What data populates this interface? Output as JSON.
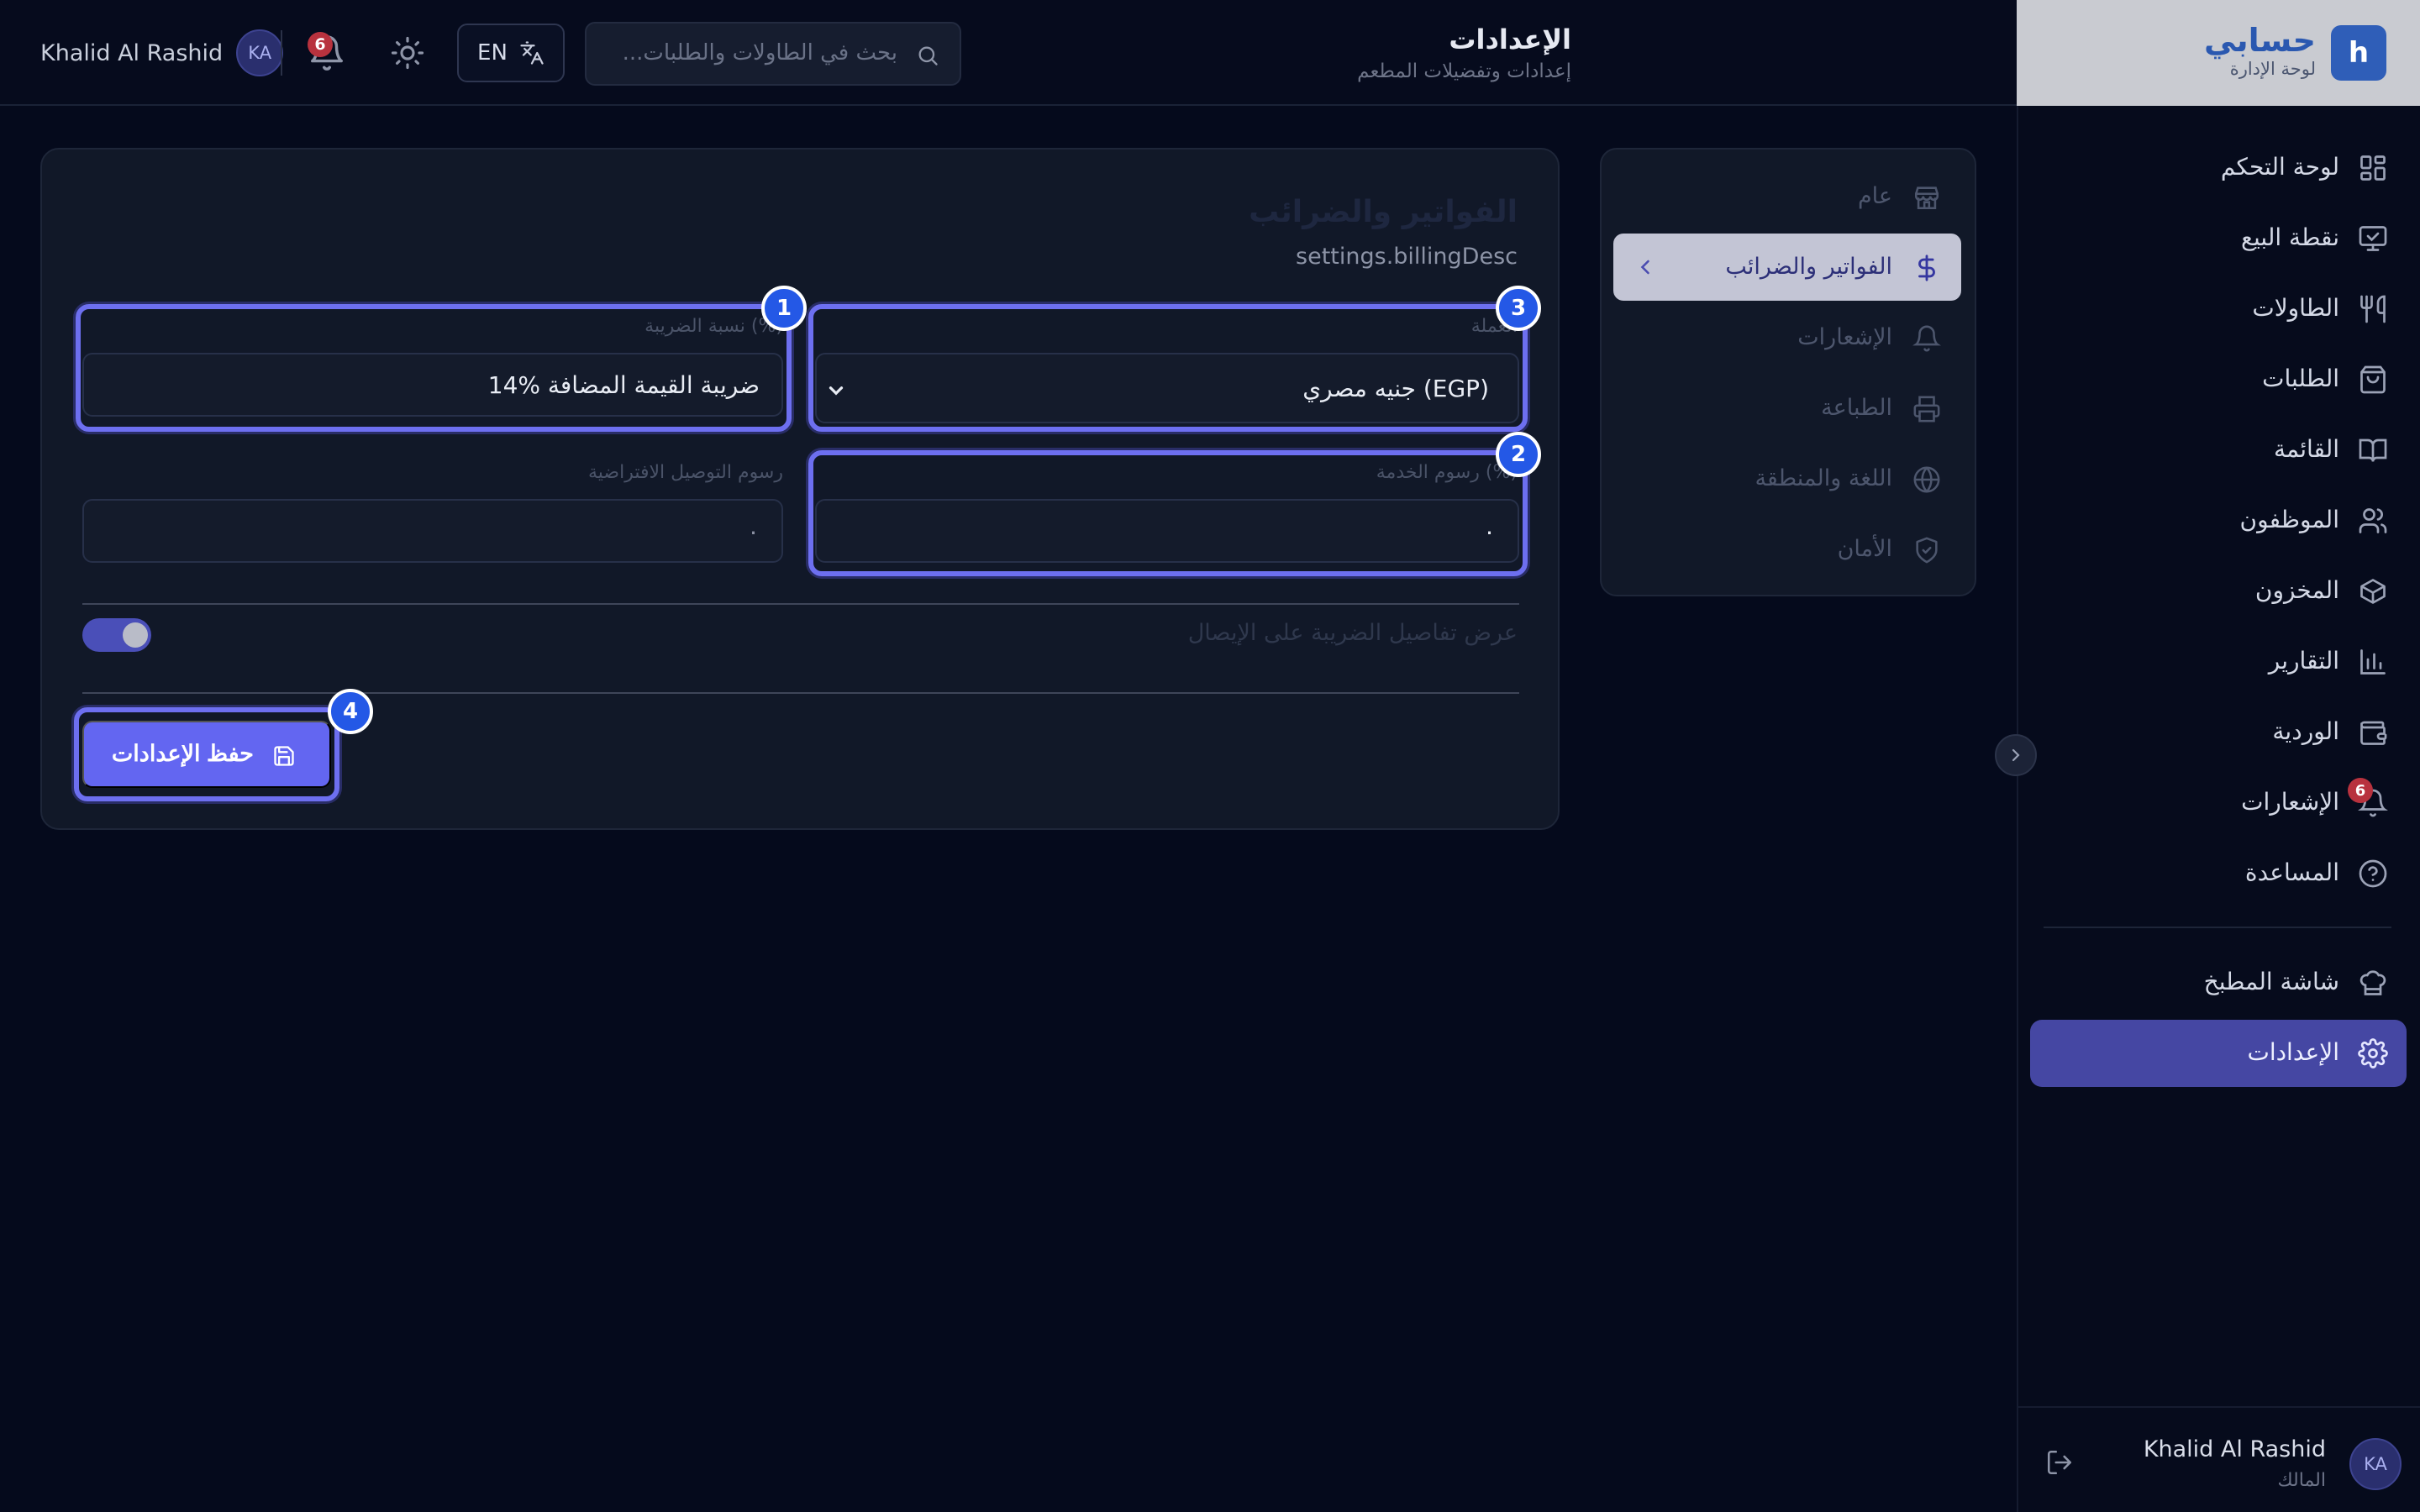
{
  "brand": {
    "name": "حسابي",
    "subtitle": "لوحة الإدارة",
    "logo_letter": "h",
    "logo_color": "#2f5eb8"
  },
  "header": {
    "title": "الإعدادات",
    "subtitle": "إعدادات وتفضيلات المطعم",
    "search_placeholder": "بحث في الطاولات والطلبات...",
    "language": "EN",
    "notifications_count": "6",
    "user": {
      "name": "Khalid Al Rashid",
      "initials": "KA"
    }
  },
  "sidebar": {
    "items": [
      {
        "label": "لوحة التحكم",
        "icon": "dashboard-grid-icon"
      },
      {
        "label": "نقطة البيع",
        "icon": "monitor-icon"
      },
      {
        "label": "الطاولات",
        "icon": "utensils-icon"
      },
      {
        "label": "الطلبات",
        "icon": "shopping-bag-icon"
      },
      {
        "label": "القائمة",
        "icon": "book-open-icon"
      },
      {
        "label": "الموظفون",
        "icon": "users-icon"
      },
      {
        "label": "المخزون",
        "icon": "package-icon"
      },
      {
        "label": "التقارير",
        "icon": "bar-chart-icon"
      },
      {
        "label": "الوردية",
        "icon": "wallet-icon"
      },
      {
        "label": "الإشعارات",
        "icon": "bell-icon",
        "badge": "6"
      },
      {
        "label": "المساعدة",
        "icon": "help-circle-icon"
      }
    ],
    "secondary_items": [
      {
        "label": "شاشة المطبخ",
        "icon": "chef-hat-icon"
      },
      {
        "label": "الإعدادات",
        "icon": "gear-icon",
        "active": true
      }
    ],
    "user": {
      "name": "Khalid Al Rashid",
      "role": "المالك",
      "initials": "KA"
    }
  },
  "settings_nav": {
    "items": [
      {
        "label": "عام",
        "icon": "store-icon"
      },
      {
        "label": "الفواتير والضرائب",
        "icon": "dollar-icon",
        "active": true
      },
      {
        "label": "الإشعارات",
        "icon": "bell-icon"
      },
      {
        "label": "الطباعة",
        "icon": "printer-icon"
      },
      {
        "label": "اللغة والمنطقة",
        "icon": "globe-icon"
      },
      {
        "label": "الأمان",
        "icon": "shield-check-icon"
      }
    ]
  },
  "billing": {
    "title": "الفواتير والضرائب",
    "description": "settings.billingDesc",
    "currency_label": "العملة",
    "currency_value": "جنيه مصري (EGP)",
    "tax_label": "نسبة الضريبة (%)",
    "tax_value": "14% ضريبة القيمة المضافة",
    "service_label": "رسوم الخدمة (%)",
    "service_value": "٠",
    "delivery_label": "رسوم التوصيل الافتراضية",
    "delivery_value": "٠",
    "toggle_label": "عرض تفاصيل الضريبة على الإيصال",
    "toggle_on": true,
    "save_label": "حفظ الإعدادات"
  },
  "markers": [
    "1",
    "2",
    "3",
    "4"
  ],
  "colors": {
    "accent": "#6366f1",
    "active_nav": "#4547a3",
    "badge": "#b8323e",
    "highlight": "#6d6ff0",
    "marker": "#2458e6"
  }
}
